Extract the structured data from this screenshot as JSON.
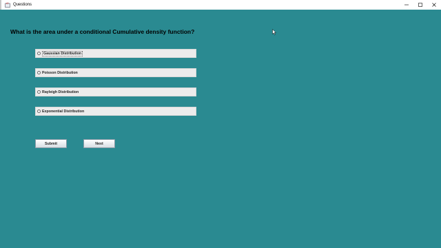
{
  "window": {
    "title": "Questions",
    "controls": [
      "minimize-icon",
      "maximize-icon",
      "close-icon"
    ]
  },
  "question": {
    "text": "What is the area under a conditional Cumulative density function?"
  },
  "options": [
    {
      "label": "Gaussian Distribution",
      "selected": false
    },
    {
      "label": "Poisson Distribution",
      "selected": false
    },
    {
      "label": "Rayleigh Distribution",
      "selected": false
    },
    {
      "label": "Exponential Distribution",
      "selected": false
    }
  ],
  "buttons": {
    "submit_label": "Submit",
    "next_label": "Next"
  },
  "colors": {
    "background": "#2a8a91",
    "option_bg": "#ececec"
  }
}
